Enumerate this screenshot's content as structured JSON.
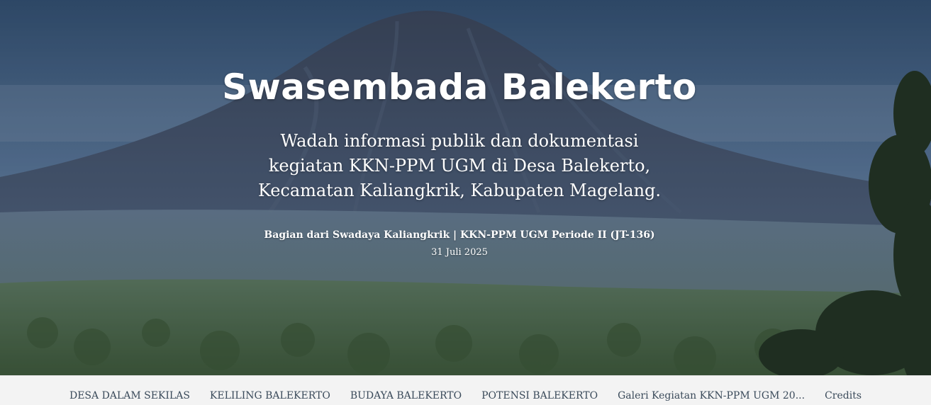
{
  "hero": {
    "title": "Swasembada Balekerto",
    "subtitle_lines": [
      "Wadah informasi publik dan dokumentasi",
      "kegiatan KKN-PPM UGM di Desa Balekerto,",
      "Kecamatan Kaliangkrik, Kabupaten Magelang."
    ],
    "meta": "Bagian dari Swadaya Kaliangkrik | KKN-PPM UGM Periode II (JT-136)",
    "date": "31 Juli 2025"
  },
  "nav": {
    "items": [
      "DESA DALAM SEKILAS",
      "KELILING BALEKERTO",
      "BUDAYA BALEKERTO",
      "POTENSI BALEKERTO",
      "Galeri Kegiatan KKN-PPM UGM 20...",
      "Credits"
    ]
  }
}
